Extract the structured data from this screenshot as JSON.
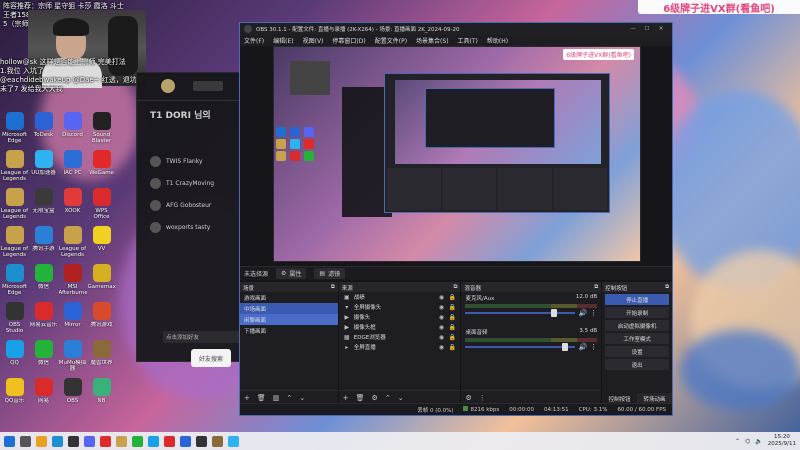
{
  "stream_info": {
    "line1": "阵容推荐：宗师 星守狙 卡莎 霞洛 斗士",
    "line2": "王者1582",
    "line3": "5（宗师）2（霞洛）"
  },
  "chat": [
    "hollow@sk 这样是否能上宗师 完美打法",
    "1.我位 入坑了",
    "@eachdidebwakeup @Dae~ 红透，退坑下",
    "未了7 发给我大大我 "
  ],
  "desktop_icons": [
    {
      "label": "Microsoft Edge",
      "icon": "edge-icon",
      "color": "#1d6fd1"
    },
    {
      "label": "ToDesk",
      "icon": "todesk-icon",
      "color": "#2b63d6"
    },
    {
      "label": "Discord",
      "icon": "discord-icon",
      "color": "#5865f2"
    },
    {
      "label": "Sound Blaster",
      "icon": "sound-icon",
      "color": "#222222"
    },
    {
      "label": "League of Legends",
      "icon": "lol-icon",
      "color": "#c7a24a"
    },
    {
      "label": "UU加速器",
      "icon": "uu-icon",
      "color": "#2db3f0"
    },
    {
      "label": "IAC PC",
      "icon": "iac-icon",
      "color": "#2b6fd6"
    },
    {
      "label": "WeGame",
      "icon": "wegame-icon",
      "color": "#e02a2a"
    },
    {
      "label": "League of Legends",
      "icon": "lol-icon",
      "color": "#c7a24a"
    },
    {
      "label": "无限宝盒",
      "icon": "box-icon",
      "color": "#3a3a3a"
    },
    {
      "label": "XOOK",
      "icon": "xook-icon",
      "color": "#e03a3a"
    },
    {
      "label": "WPS Office",
      "icon": "wps-icon",
      "color": "#d92b2b"
    },
    {
      "label": "League of Legends",
      "icon": "lol-icon",
      "color": "#c7a24a"
    },
    {
      "label": "腾讯手游",
      "icon": "tencent-icon",
      "color": "#2b7fd6"
    },
    {
      "label": "League of Legends",
      "icon": "lol-icon",
      "color": "#c7a24a"
    },
    {
      "label": "VV",
      "icon": "vv-icon",
      "color": "#f0d020"
    },
    {
      "label": "Microsoft Edge",
      "icon": "edge-icon",
      "color": "#1d8fd1"
    },
    {
      "label": "微信",
      "icon": "wechat-icon",
      "color": "#23b23a"
    },
    {
      "label": "MSI Afterburner",
      "icon": "msi-icon",
      "color": "#b02020"
    },
    {
      "label": "Gamemax",
      "icon": "gm-icon",
      "color": "#d4b020"
    },
    {
      "label": "OBS Studio",
      "icon": "obs-icon",
      "color": "#333333"
    },
    {
      "label": "网易云音乐",
      "icon": "netease-icon",
      "color": "#d92b2b"
    },
    {
      "label": "Mirror",
      "icon": "mirror-icon",
      "color": "#2b63d6"
    },
    {
      "label": "腾讯游戏",
      "icon": "tgame-icon",
      "color": "#d94a2b"
    },
    {
      "label": "QQ",
      "icon": "qq-icon",
      "color": "#1aa0e8"
    },
    {
      "label": "微信",
      "icon": "wechat-icon",
      "color": "#23b23a"
    },
    {
      "label": "MuMu模拟器",
      "icon": "mumu-icon",
      "color": "#2b7fd6"
    },
    {
      "label": "魔兽世界",
      "icon": "wow-icon",
      "color": "#8a6a3a"
    },
    {
      "label": "QQ音乐",
      "icon": "qqmusic-icon",
      "color": "#f0c020"
    },
    {
      "label": "网易",
      "icon": "netease2-icon",
      "color": "#d92b2b"
    },
    {
      "label": "OBS",
      "icon": "obs2-icon",
      "color": "#333333"
    },
    {
      "label": "NB",
      "icon": "nb-icon",
      "color": "#3ab07a"
    }
  ],
  "lol_panel": {
    "team": "T1 DORI 님의",
    "rows": [
      "TWIS Flanky",
      "T1 CrazyMoving",
      "AFG Gobosteur",
      "woxports tasty"
    ],
    "bottom": "点击添加好友",
    "find": "好友搜索"
  },
  "obs": {
    "title": "OBS 30.1.1 - 配置文件: 直播与录播 (2K-X264) - 场景: 直播画面 2K_2024-09-20",
    "menu": [
      "文件(F)",
      "编辑(E)",
      "视图(V)",
      "停靠窗口(D)",
      "配置文件(P)",
      "场景集合(S)",
      "工具(T)",
      "帮助(H)"
    ],
    "preview_banner": "6级牌子进VX群(看鱼吧)",
    "source_bar": {
      "label": "未选择源",
      "btn1": "属性",
      "btn2": "滤镜"
    },
    "docks": {
      "scenes_title": "场景",
      "sources_title": "来源",
      "mixer_title": "混音器",
      "controls_title": "控制按钮"
    },
    "scenes": [
      "游戏画面",
      "中场画面",
      "闲聊画面",
      "下播画面"
    ],
    "sources": [
      {
        "name": "战绩"
      },
      {
        "name": "全屏摄像头"
      },
      {
        "name": "摄像头"
      },
      {
        "name": "摄像头框"
      },
      {
        "name": "EDGE浏览器"
      },
      {
        "name": "全屏直播"
      }
    ],
    "mixer": [
      {
        "name": "麦克风/Aux",
        "db": "12.0 dB"
      },
      {
        "name": "桌面音频",
        "db": "3.5 dB"
      }
    ],
    "controls": [
      "停止直播",
      "开始录制",
      "启动虚拟摄像机",
      "工作室模式",
      "设置",
      "退出"
    ],
    "bottom_tabs": [
      "控制按钮",
      "转场动画"
    ],
    "status": {
      "dropped": "丢帧 0 (0.0%)",
      "bitrate": "8216 kbps",
      "time1": "00:00:00",
      "time2": "04:13:51",
      "cpu": "CPU: 3.1%",
      "fps": "60.00 / 60.00 FPS"
    }
  },
  "top_banner": "6级牌子进VX群(看鱼吧)",
  "taskbar": {
    "time": "15:20",
    "date": "2025/9/11"
  }
}
